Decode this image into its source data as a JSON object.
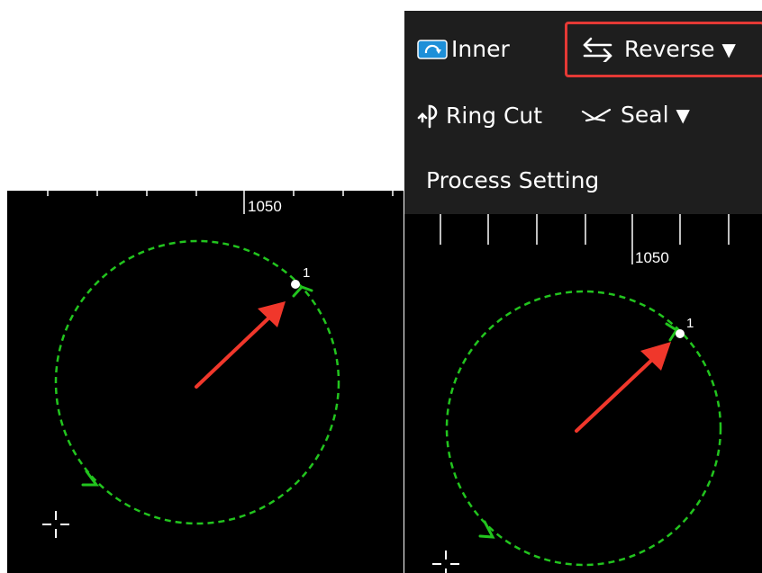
{
  "toolbar": {
    "inner_label": "Inner",
    "reverse_label": "Reverse",
    "ring_cut_label": "Ring Cut",
    "seal_label": "Seal",
    "process_setting_label": "Process Setting",
    "caret": "▼"
  },
  "left_view": {
    "ruler_label": "1050",
    "start_point_label": "1"
  },
  "right_view": {
    "ruler_label": "1050",
    "start_point_label": "1"
  },
  "colors": {
    "path": "#22c41e",
    "arrow": "#f0372b",
    "highlight": "#e53935",
    "toolbar_bg": "#1e1e1e",
    "canvas_bg": "#000000"
  },
  "icons": [
    "inner-icon",
    "reverse-icon",
    "ring-cut-icon",
    "seal-icon",
    "caret-down-icon",
    "crosshair-icon"
  ]
}
